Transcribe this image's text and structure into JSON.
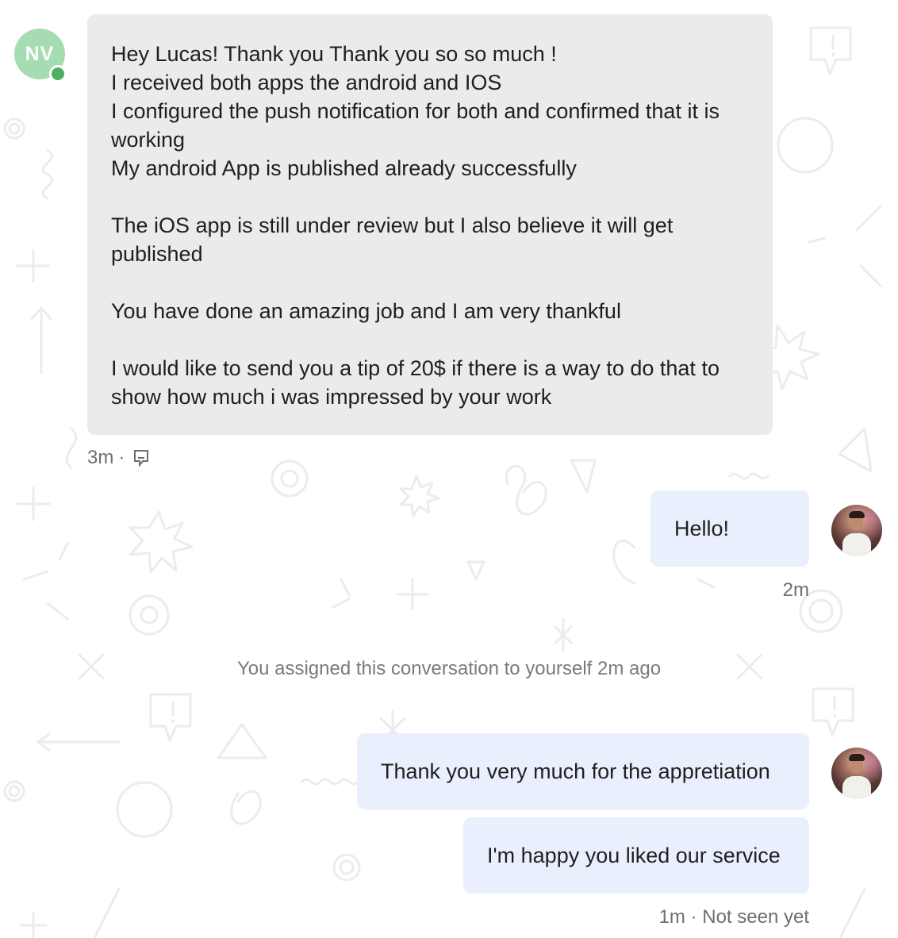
{
  "incoming": {
    "avatar_initials": "NV",
    "avatar_color": "#a6dcb2",
    "presence": "online",
    "lines": [
      "Hey Lucas! Thank you Thank you so so much !",
      "I received both apps the android and IOS",
      "I configured the push notification for both and confirmed that it is",
      "working",
      "My android App is published already successfully",
      "",
      "The iOS app is still under review but I also believe it will get",
      "published",
      "",
      "You have done an amazing job and I am very thankful",
      "",
      "I would like to send you a tip of 20$ if there is a way to do that to",
      "show how much i was impressed by your work"
    ],
    "time": "3m",
    "separator": "·",
    "note_icon": "note-icon"
  },
  "outgoing_1": {
    "text": "Hello!",
    "time": "2m"
  },
  "system": {
    "text": "You assigned this conversation to yourself 2m ago"
  },
  "outgoing_2": {
    "messages": [
      "Thank you very much for the appretiation",
      "I'm happy you liked our service"
    ],
    "status": "1m · Not seen yet"
  },
  "colors": {
    "incoming_bubble": "#ebebeb",
    "outgoing_bubble": "#e9effc",
    "presence": "#4caf62",
    "meta_text": "#6f6f6f"
  }
}
